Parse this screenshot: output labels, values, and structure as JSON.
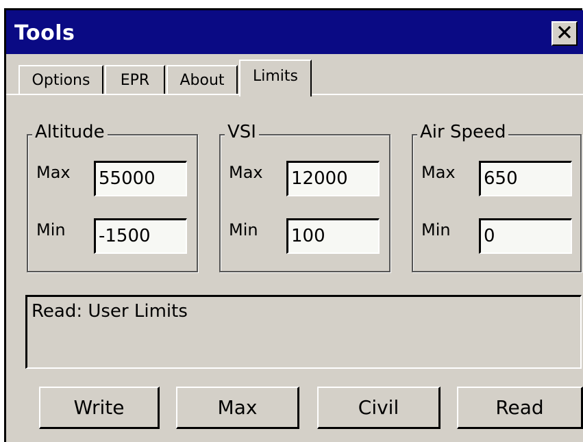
{
  "window": {
    "title": "Tools",
    "close_icon": "close-icon"
  },
  "tabs": [
    {
      "label": "Options"
    },
    {
      "label": "EPR"
    },
    {
      "label": "About"
    },
    {
      "label": "Limits"
    }
  ],
  "groups": {
    "altitude": {
      "title": "Altitude",
      "max_label": "Max",
      "max_value": "55000",
      "min_label": "Min",
      "min_value": "-1500"
    },
    "vsi": {
      "title": "VSI",
      "max_label": "Max",
      "max_value": "12000",
      "min_label": "Min",
      "min_value": "100"
    },
    "airspeed": {
      "title": "Air Speed",
      "max_label": "Max",
      "max_value": "650",
      "min_label": "Min",
      "min_value": "0"
    }
  },
  "status": {
    "text": "Read: User Limits"
  },
  "buttons": {
    "write": "Write",
    "max": "Max",
    "civil": "Civil",
    "read": "Read"
  },
  "colors": {
    "titlebar": "#0a0a84",
    "face": "#d4d0c8",
    "field": "#f7f8f4"
  }
}
